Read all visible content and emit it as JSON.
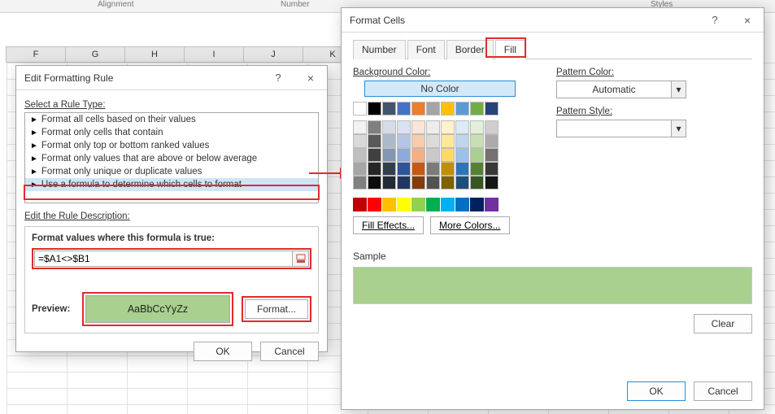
{
  "ribbon": {
    "group_alignment": "Alignment",
    "group_number": "Number",
    "group_styles": "Styles"
  },
  "columns": [
    "F",
    "G",
    "H",
    "I",
    "J",
    "K"
  ],
  "edit_rule": {
    "title": "Edit Formatting Rule",
    "help": "?",
    "close": "×",
    "select_type_label": "Select a Rule Type:",
    "rule_types": [
      "Format all cells based on their values",
      "Format only cells that contain",
      "Format only top or bottom ranked values",
      "Format only values that are above or below average",
      "Format only unique or duplicate values",
      "Use a formula to determine which cells to format"
    ],
    "edit_desc_label": "Edit the Rule Description:",
    "formula_label": "Format values where this formula is true:",
    "formula_value": "=$A1<>$B1",
    "preview_label": "Preview:",
    "preview_text": "AaBbCcYyZz",
    "format_btn": "Format...",
    "ok": "OK",
    "cancel": "Cancel"
  },
  "format_cells": {
    "title": "Format Cells",
    "help": "?",
    "close": "×",
    "tabs": [
      "Number",
      "Font",
      "Border",
      "Fill"
    ],
    "active_tab": "Fill",
    "bg_color_label": "Background Color:",
    "no_color": "No Color",
    "pattern_color_label": "Pattern Color:",
    "pattern_color_value": "Automatic",
    "pattern_style_label": "Pattern Style:",
    "fill_effects": "Fill Effects...",
    "more_colors": "More Colors...",
    "sample_label": "Sample",
    "clear": "Clear",
    "ok": "OK",
    "cancel": "Cancel",
    "theme_row_top": [
      "#ffffff",
      "#000000",
      "#44546a",
      "#4472c4",
      "#ed7d31",
      "#a5a5a5",
      "#ffc000",
      "#5b9bd5",
      "#70ad47",
      "#264478"
    ],
    "theme_shades": [
      [
        "#f2f2f2",
        "#808080",
        "#d6dce5",
        "#d9e1f2",
        "#fce4d6",
        "#ededed",
        "#fff2cc",
        "#ddebf7",
        "#e2efda",
        "#d0cece"
      ],
      [
        "#d9d9d9",
        "#595959",
        "#acb9ca",
        "#b4c6e7",
        "#f8cbad",
        "#dbdbdb",
        "#ffe699",
        "#bdd7ee",
        "#c6e0b4",
        "#aeaaaa"
      ],
      [
        "#bfbfbf",
        "#404040",
        "#8497b0",
        "#8ea9db",
        "#f4b084",
        "#c9c9c9",
        "#ffd966",
        "#9bc2e6",
        "#a9d08e",
        "#757171"
      ],
      [
        "#a6a6a6",
        "#262626",
        "#333f4f",
        "#305496",
        "#c65911",
        "#7b7b7b",
        "#bf8f00",
        "#2f75b5",
        "#548235",
        "#3a3838"
      ],
      [
        "#808080",
        "#0d0d0d",
        "#222b35",
        "#203764",
        "#833c0c",
        "#525252",
        "#806000",
        "#1f4e78",
        "#375623",
        "#161616"
      ]
    ],
    "standard_colors": [
      "#c00000",
      "#ff0000",
      "#ffc000",
      "#ffff00",
      "#92d050",
      "#00b050",
      "#00b0f0",
      "#0070c0",
      "#002060",
      "#7030a0"
    ]
  }
}
